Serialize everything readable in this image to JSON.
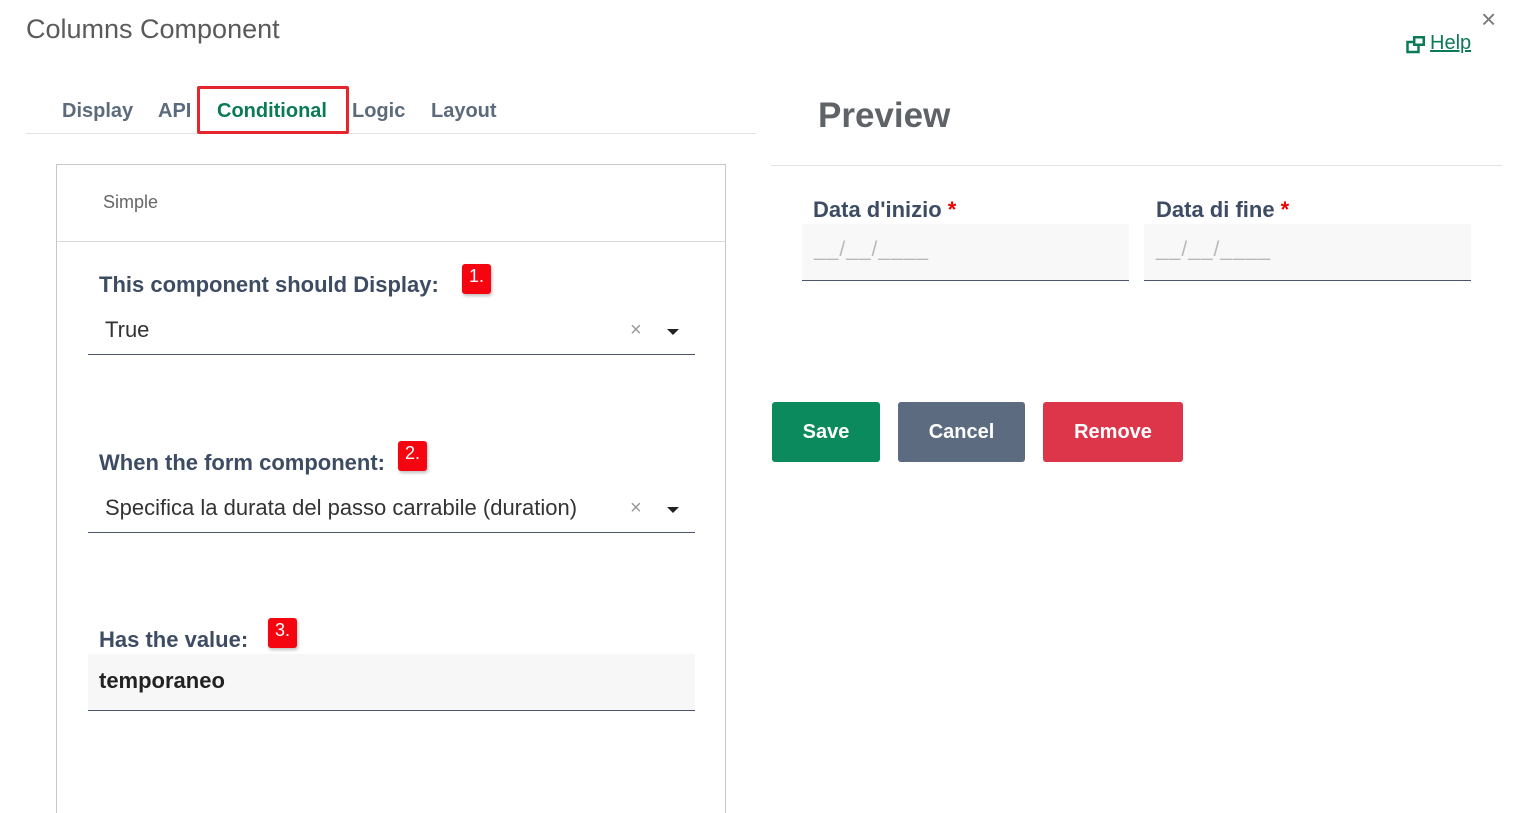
{
  "dialog": {
    "title": "Columns Component",
    "help_label": "Help",
    "close_glyph": "×"
  },
  "tabs": [
    {
      "label": "Display",
      "active": false
    },
    {
      "label": "API",
      "active": false
    },
    {
      "label": "Conditional",
      "active": true
    },
    {
      "label": "Logic",
      "active": false
    },
    {
      "label": "Layout",
      "active": false
    }
  ],
  "conditional": {
    "panel_title": "Simple",
    "display_label": "This component should Display:",
    "display_value": "True",
    "when_label": "When the form component:",
    "when_value": "Specifica la durata del passo carrabile (duration)",
    "value_label": "Has the value:",
    "value": "temporaneo",
    "clear_glyph": "×"
  },
  "badges": [
    "1.",
    "2.",
    "3."
  ],
  "preview": {
    "title": "Preview",
    "fields": [
      {
        "label": "Data d'inizio",
        "required_mark": "*",
        "placeholder": "__/__/____"
      },
      {
        "label": "Data di fine",
        "required_mark": "*",
        "placeholder": "__/__/____"
      }
    ]
  },
  "buttons": {
    "save": "Save",
    "cancel": "Cancel",
    "remove": "Remove"
  },
  "colors": {
    "accent": "#0b7a55",
    "save": "#0b8a5e",
    "cancel": "#5c6b80",
    "remove": "#dd3549",
    "highlight": "#e5262c",
    "badge": "#f5050f"
  },
  "icons": {
    "help": "external-windows-icon",
    "close": "close-icon",
    "caret": "caret-down-icon",
    "clear": "clear-icon"
  }
}
